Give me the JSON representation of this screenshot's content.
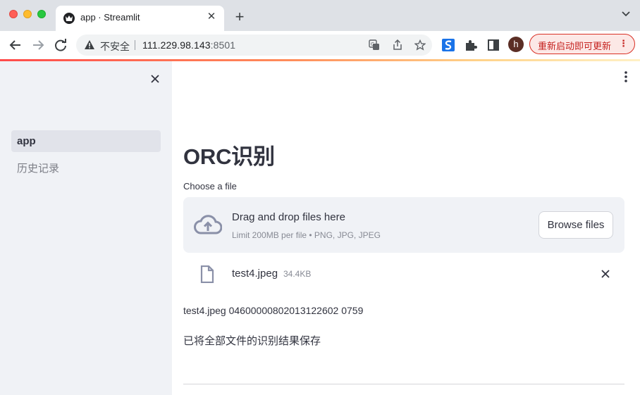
{
  "browser": {
    "tab_title": "app · Streamlit",
    "tab_close": "✕",
    "new_tab": "+",
    "security_label": "不安全",
    "url_host": "111.229.98.143",
    "url_port": ":8501",
    "profile_initial": "h",
    "update_label": "重新启动即可更新",
    "update_menu": "⋮"
  },
  "sidebar": {
    "items": [
      {
        "label": "app",
        "active": true
      },
      {
        "label": "历史记录",
        "active": false
      }
    ]
  },
  "main": {
    "title": "ORC识别",
    "uploader": {
      "label": "Choose a file",
      "drop_title": "Drag and drop files here",
      "drop_hint": "Limit 200MB per file • PNG, JPG, JPEG",
      "browse_label": "Browse files"
    },
    "uploaded_file": {
      "name": "test4.jpeg",
      "size": "34.4KB"
    },
    "result_text": "test4.jpeg 04600000802013122602 0759",
    "saved_message": "已将全部文件的识别结果保存"
  },
  "colors": {
    "accent": "#ff4b4b",
    "sidebar_bg": "#f0f2f6",
    "text": "#31333f",
    "update_red": "#d93025"
  }
}
